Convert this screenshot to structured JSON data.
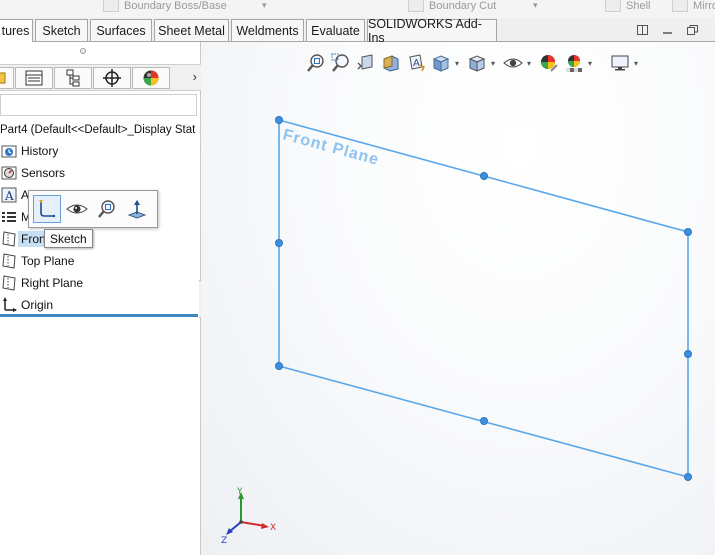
{
  "ribbon": {
    "boundary_boss": "Boundary Boss/Base",
    "boundary_cut": "Boundary Cut",
    "shell": "Shell",
    "mirror": "Mirro"
  },
  "tabs": [
    {
      "label": "tures",
      "active": true
    },
    {
      "label": "Sketch",
      "active": false
    },
    {
      "label": "Surfaces",
      "active": false
    },
    {
      "label": "Sheet Metal",
      "active": false
    },
    {
      "label": "Weldments",
      "active": false
    },
    {
      "label": "Evaluate",
      "active": false
    },
    {
      "label": "SOLIDWORKS Add-Ins",
      "active": false
    }
  ],
  "feature_tree": {
    "root": "Part4  (Default<<Default>_Display Stat",
    "items": [
      {
        "label": "History",
        "icon": "history-folder-icon"
      },
      {
        "label": "Sensors",
        "icon": "sensors-icon"
      },
      {
        "label": "A",
        "icon": "annotations-icon"
      },
      {
        "label": "M",
        "icon": "material-icon"
      },
      {
        "label": "Fron",
        "icon": "plane-icon",
        "selected": true
      },
      {
        "label": "Top Plane",
        "icon": "plane-icon"
      },
      {
        "label": "Right Plane",
        "icon": "plane-icon"
      },
      {
        "label": "Origin",
        "icon": "origin-icon"
      }
    ]
  },
  "context_toolbar": {
    "tooltip": "Sketch",
    "buttons": [
      "sketch-icon",
      "eye-icon",
      "zoom-to-selection-icon",
      "normal-to-icon"
    ]
  },
  "viewport": {
    "plane_label": "Front Plane",
    "triad": {
      "x": "X",
      "y": "Y",
      "z": "Z"
    },
    "plane_color": "#5aa7ea"
  },
  "colors": {
    "accent_blue": "#3d8ac0",
    "selection_bg": "#c7dff5",
    "triad_x": "#d02a2a",
    "triad_y": "#2a9a2a",
    "triad_z": "#2a3fbf"
  }
}
